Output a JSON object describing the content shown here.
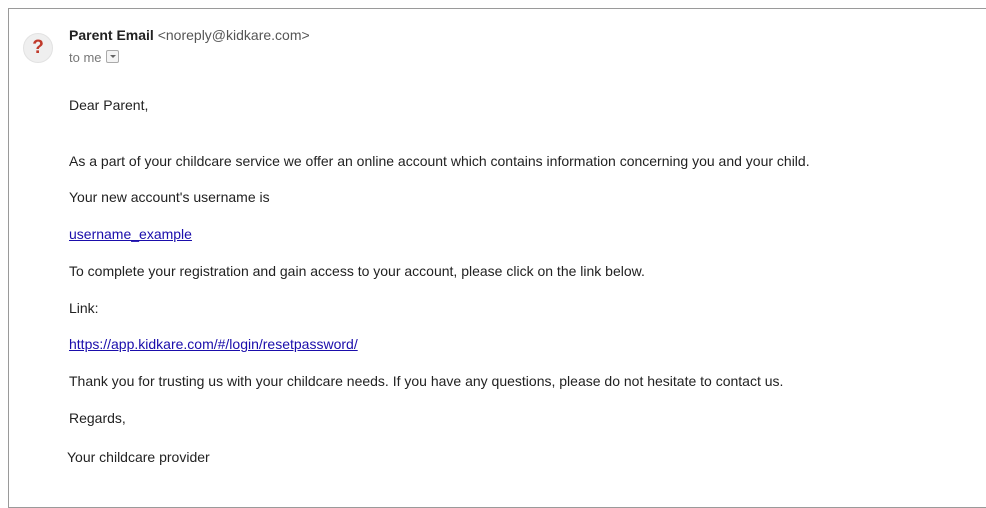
{
  "email": {
    "sender_name": "Parent Email",
    "sender_address": "<noreply@kidkare.com>",
    "recipient_line": "to me",
    "avatar_glyph": "?",
    "body": {
      "greeting": "Dear Parent,",
      "intro": "As a part of your childcare service we offer an online account which contains information concerning you and your child.",
      "username_label": "Your new account's username is",
      "username": "username_example",
      "instructions": "To complete your registration and gain access to your account, please click on the link below.",
      "link_label": "Link:",
      "link_url": "https://app.kidkare.com/#/login/resetpassword/",
      "thanks": "Thank you for trusting us with your childcare needs. If you have any questions, please do not hesitate to contact us.",
      "closing": "Regards,",
      "signature": "Your childcare provider"
    }
  },
  "icons": {
    "avatar": "unknown-sender-icon",
    "recipient_dropdown": "chevron-down-icon"
  },
  "colors": {
    "link": "#1a0dab",
    "avatar_glyph": "#c03a2b",
    "border": "#9a9a9a"
  }
}
